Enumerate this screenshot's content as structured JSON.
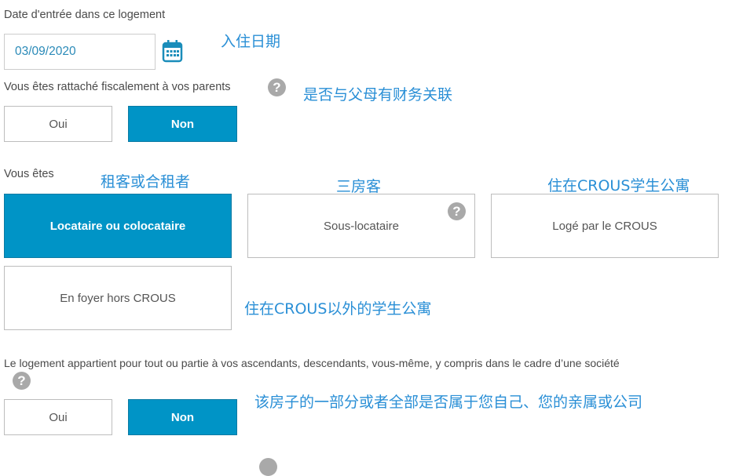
{
  "date_section": {
    "label": "Date d'entrée dans ce logement",
    "value": "03/09/2020",
    "note": "入住日期"
  },
  "fiscal": {
    "label": "Vous êtes rattaché fiscalement à vos parents",
    "note": "是否与父母有财务关联",
    "oui": "Oui",
    "non": "Non",
    "selected": "Non"
  },
  "status": {
    "label": "Vous êtes",
    "options": [
      {
        "label": "Locataire ou colocataire",
        "note": "租客或合租者",
        "selected": true
      },
      {
        "label": "Sous-locataire",
        "note": "三房客",
        "selected": false
      },
      {
        "label": "Logé par le CROUS",
        "note": "住在CROUS学生公寓",
        "selected": false
      },
      {
        "label": "En foyer hors CROUS",
        "note": "住在CROUS以外的学生公寓",
        "selected": false
      }
    ]
  },
  "ownership": {
    "label": "Le logement appartient pour tout ou partie à vos ascendants, descendants, vous-même, y compris dans le cadre d’une société",
    "note": "该房子的一部分或者全部是否属于您自己、您的亲属或公司",
    "oui": "Oui",
    "non": "Non",
    "selected": "Non"
  },
  "icons": {
    "help": "?",
    "calendar": "calendar-icon"
  },
  "colors": {
    "accent": "#0094c6",
    "note": "#2a8fd6"
  }
}
